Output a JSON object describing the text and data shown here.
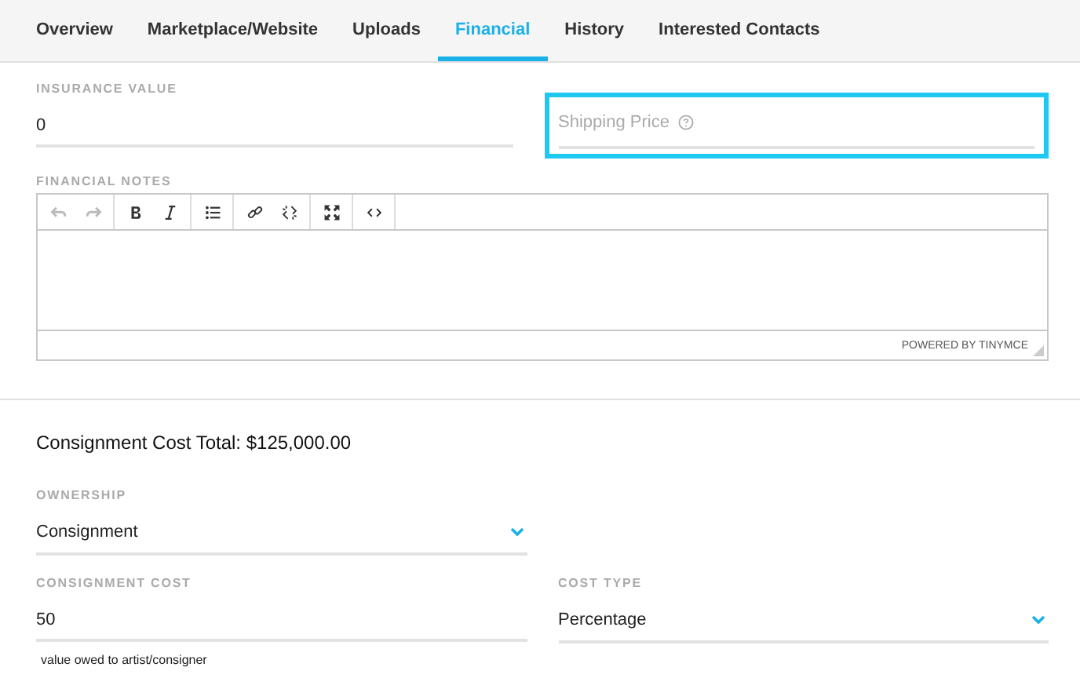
{
  "tabs": [
    {
      "label": "Overview",
      "selected": false
    },
    {
      "label": "Marketplace/Website",
      "selected": false
    },
    {
      "label": "Uploads",
      "selected": false
    },
    {
      "label": "Financial",
      "selected": true
    },
    {
      "label": "History",
      "selected": false
    },
    {
      "label": "Interested Contacts",
      "selected": false
    }
  ],
  "insurance": {
    "label": "INSURANCE VALUE",
    "value": "0"
  },
  "shipping": {
    "placeholder": "Shipping Price",
    "highlighted": true
  },
  "notes": {
    "label": "FINANCIAL NOTES",
    "toolbar": [
      {
        "buttons": [
          {
            "kind": "undo",
            "disabled": true
          },
          {
            "kind": "redo",
            "disabled": true
          }
        ]
      },
      {
        "buttons": [
          {
            "kind": "bold",
            "disabled": false
          },
          {
            "kind": "italic",
            "disabled": false
          }
        ]
      },
      {
        "buttons": [
          {
            "kind": "list",
            "disabled": false
          }
        ]
      },
      {
        "buttons": [
          {
            "kind": "link",
            "disabled": false
          },
          {
            "kind": "unlink",
            "disabled": false
          }
        ]
      },
      {
        "buttons": [
          {
            "kind": "fullscreen",
            "disabled": false
          }
        ]
      },
      {
        "buttons": [
          {
            "kind": "code",
            "disabled": false
          }
        ]
      }
    ],
    "status": "POWERED BY TINYMCE"
  },
  "total": "Consignment Cost Total: $125,000.00",
  "ownership": {
    "label": "OWNERSHIP",
    "value": "Consignment"
  },
  "consignment_cost": {
    "label": "CONSIGNMENT COST",
    "value": "50",
    "helper": "value owed to artist/consigner"
  },
  "cost_type": {
    "label": "COST TYPE",
    "value": "Percentage"
  }
}
